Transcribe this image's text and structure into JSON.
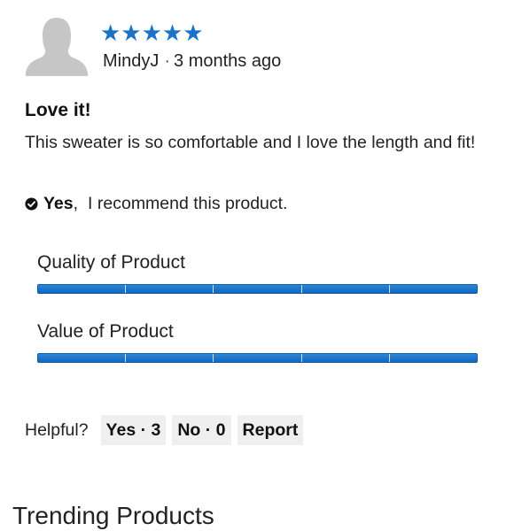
{
  "review": {
    "rating": 5,
    "stars_text": "★★★★★",
    "reviewer": "MindyJ",
    "separator": "·",
    "posted": "3 months ago",
    "title": "Love it!",
    "body": "This sweater is so comfortable and I love the length and fit!"
  },
  "recommendation": {
    "icon": "check-circle-icon",
    "answer": "Yes",
    "comma": ",",
    "text": "I recommend this product."
  },
  "metrics": [
    {
      "label": "Quality of Product",
      "segments_filled": 5,
      "segments_total": 5
    },
    {
      "label": "Value of Product",
      "segments_filled": 5,
      "segments_total": 5
    }
  ],
  "helpful": {
    "prompt": "Helpful?",
    "yes_label": "Yes · 3",
    "no_label": "No · 0",
    "report_label": "Report"
  },
  "section_title": "Trending Products",
  "colors": {
    "star": "#1a73c4",
    "bar": "#1673c9",
    "button_bg": "#efefef",
    "avatar": "#c6c6c6"
  }
}
